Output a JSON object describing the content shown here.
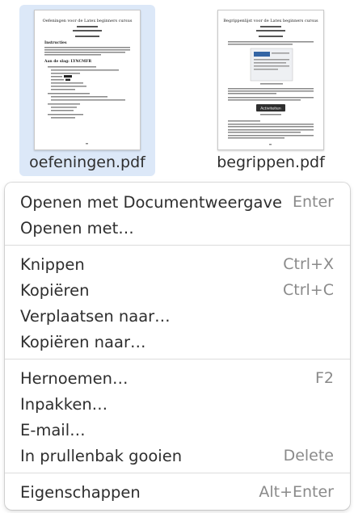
{
  "files": [
    {
      "name": "oefeningen.pdf",
      "selected": true,
      "preview": {
        "title": "Oefeningen voor de Latex beginners cursus",
        "heading": "Instructies",
        "section": "Aan de slag: LYNCMFR"
      }
    },
    {
      "name": "begrippen.pdf",
      "selected": false,
      "preview": {
        "title": "Begrippenlijst voor de Latex beginners cursus",
        "button": "Activiteiten"
      }
    }
  ],
  "menu": {
    "items": [
      {
        "label": "Openen met Documentweergave",
        "accel": "Enter"
      },
      {
        "label": "Openen met…",
        "accel": ""
      },
      {
        "label": "Knippen",
        "accel": "Ctrl+X"
      },
      {
        "label": "Kopiëren",
        "accel": "Ctrl+C"
      },
      {
        "label": "Verplaatsen naar…",
        "accel": ""
      },
      {
        "label": "Kopiëren naar…",
        "accel": ""
      },
      {
        "label": "Hernoemen…",
        "accel": "F2"
      },
      {
        "label": "Inpakken…",
        "accel": ""
      },
      {
        "label": "E-mail…",
        "accel": ""
      },
      {
        "label": "In prullenbak gooien",
        "accel": "Delete"
      },
      {
        "label": "Eigenschappen",
        "accel": "Alt+Enter"
      }
    ]
  },
  "colors": {
    "selection": "#dce8f8",
    "text": "#2e2e2e",
    "accelerator": "#8a8a8a"
  }
}
